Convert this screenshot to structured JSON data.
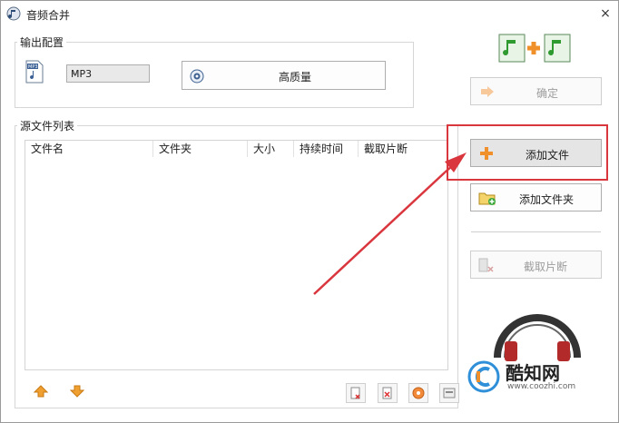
{
  "window": {
    "title": "音频合并",
    "close_glyph": "×"
  },
  "output_config": {
    "label": "输出配置",
    "format_value": "MP3",
    "quality_button": "高质量"
  },
  "right_panel": {
    "confirm_button": "确定",
    "add_file_button": "添加文件",
    "add_folder_button": "添加文件夹",
    "clip_button": "截取片断"
  },
  "source_list": {
    "label": "源文件列表",
    "columns": [
      "文件名",
      "文件夹",
      "大小",
      "持续时间",
      "截取片断"
    ]
  },
  "watermark": {
    "brand": "酷知网",
    "url": "www.coozhi.com"
  },
  "colors": {
    "highlight_box": "#d9363e",
    "arrow": "#d9363e",
    "add_icon": "#f0902a",
    "up_arrow": "#f0a030",
    "down_arrow": "#f0a030",
    "music_note": "#2f9a2f"
  }
}
